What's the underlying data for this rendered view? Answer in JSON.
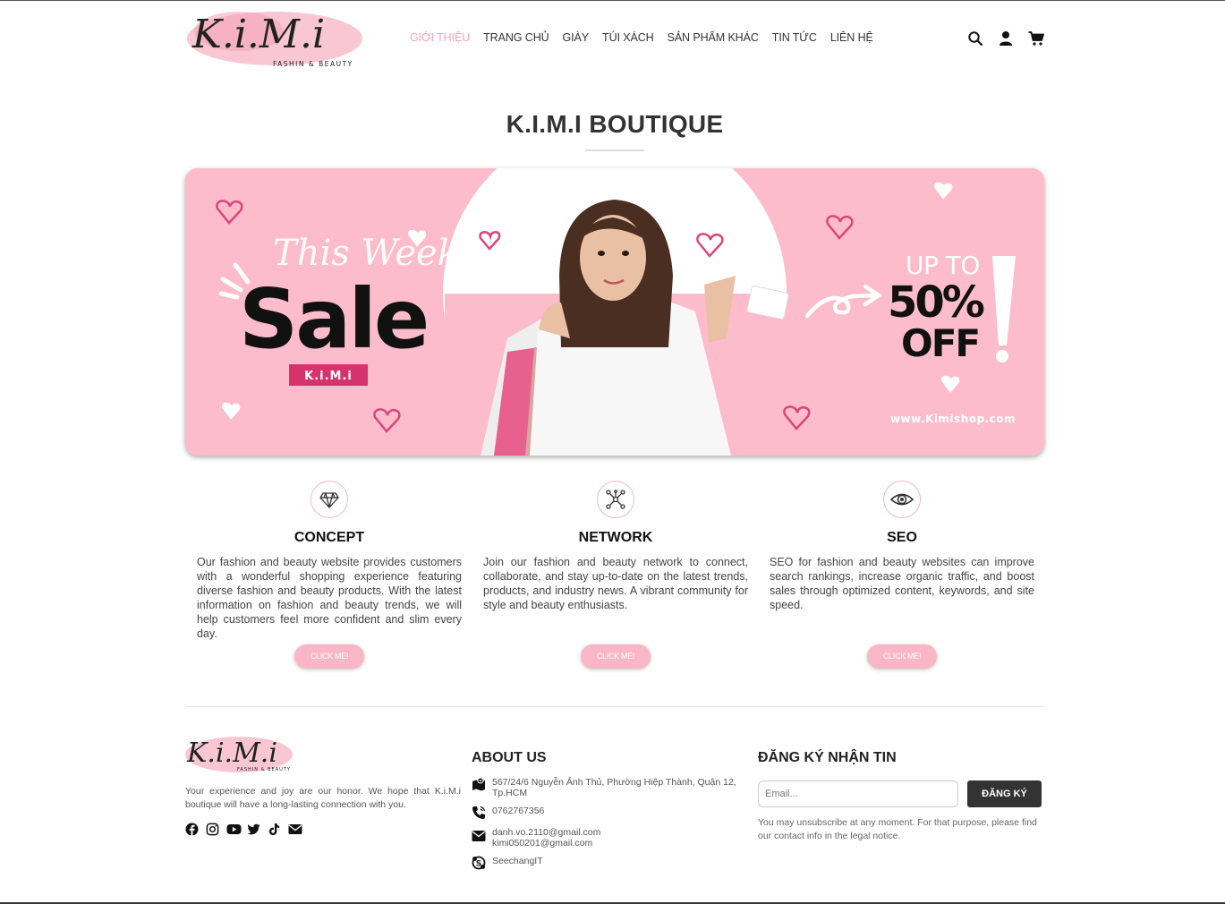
{
  "header": {
    "logo_text": "K.i.M.i",
    "logo_sub": "FASHIN & BEAUTY",
    "nav": [
      {
        "label": "GIỚI THIỆU",
        "active": true
      },
      {
        "label": "TRANG CHỦ",
        "active": false
      },
      {
        "label": "GIÀY",
        "active": false
      },
      {
        "label": "TÚI XÁCH",
        "active": false
      },
      {
        "label": "SẢN PHẨM KHÁC",
        "active": false
      },
      {
        "label": "TIN TỨC",
        "active": false
      },
      {
        "label": "LIÊN HỆ",
        "active": false
      }
    ],
    "icons": [
      "search-icon",
      "user-icon",
      "cart-icon"
    ]
  },
  "page": {
    "title": "K.I.M.I BOUTIQUE"
  },
  "banner": {
    "this_week": "This Week",
    "sale": "Sale",
    "brand": "K.i.M.i",
    "up_to": "UP TO",
    "percent": "50%",
    "off": "OFF",
    "url": "www.Kimishop.com"
  },
  "features": [
    {
      "icon": "diamond-icon",
      "title": "CONCEPT",
      "text": "Our fashion and beauty website provides customers with a wonderful shopping experience featuring diverse fashion and beauty products. With the latest information on fashion and beauty trends, we will help customers feel more confident and slim every day.",
      "button": "CLICK ME!"
    },
    {
      "icon": "network-icon",
      "title": "NETWORK",
      "text": "Join our fashion and beauty network to connect, collaborate, and stay up-to-date on the latest trends, products, and industry news. A vibrant community for style and beauty enthusiasts.",
      "button": "CLICK ME!"
    },
    {
      "icon": "eye-icon",
      "title": "SEO",
      "text": "SEO for fashion and beauty websites can improve search rankings, increase organic traffic, and boost sales through optimized content, keywords, and site speed.",
      "button": "CLICK ME!"
    }
  ],
  "footer": {
    "about_text": "Your experience and joy are our honor. We hope that K.i.M.i boutique will have a long-lasting connection with you.",
    "socials": [
      "facebook-icon",
      "instagram-icon",
      "youtube-icon",
      "twitter-icon",
      "tiktok-icon",
      "mail-icon"
    ],
    "about_heading": "ABOUT US",
    "address": "567/24/6 Nguyễn Ảnh Thủ, Phường Hiệp Thành, Quận 12, Tp.HCM",
    "phone": "0762767356",
    "email1": "danh.vo.2110@gmail.com",
    "email2": "kimi050201@gmail.com",
    "skype": "SeechangIT",
    "newsletter_heading": "ĐĂNG KÝ NHẬN TIN",
    "email_placeholder": "Email...",
    "subscribe": "ĐĂNG KÝ",
    "legal": "You may unsubscribe at any moment. For that purpose, please find our contact info in the legal notice."
  },
  "colors": {
    "accent_pink": "#f9b6c6",
    "banner_pink": "#fdbccb",
    "dark": "#333333"
  }
}
